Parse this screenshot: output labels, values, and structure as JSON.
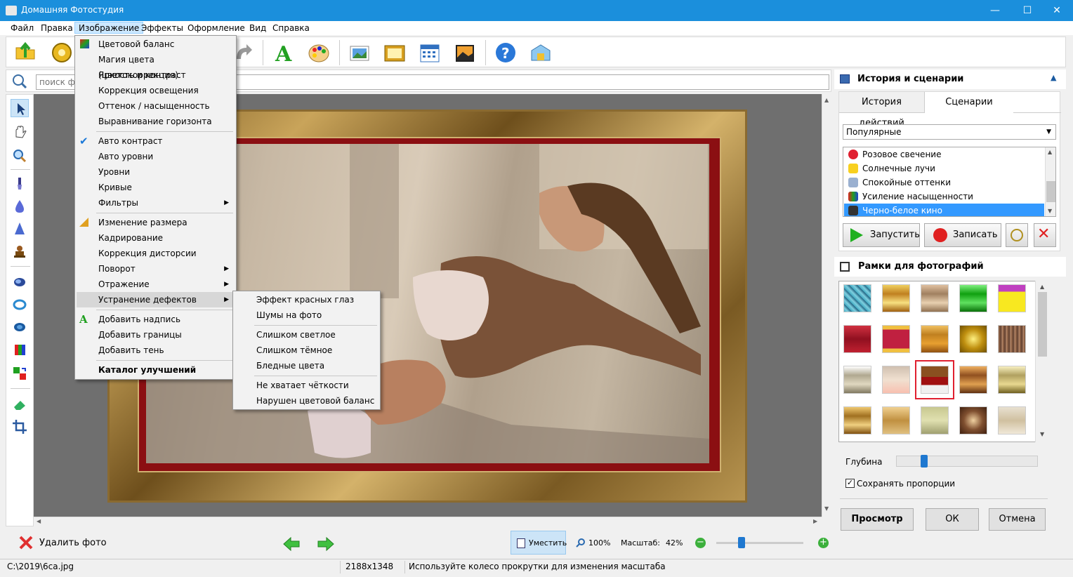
{
  "window": {
    "title": "Домашняя Фотостудия",
    "minimize": "—",
    "maximize": "☐",
    "close": "✕"
  },
  "menubar": [
    "Файл",
    "Правка",
    "Изображение",
    "Эффекты",
    "Оформление",
    "Вид",
    "Справка"
  ],
  "search": {
    "placeholder": "поиск функции"
  },
  "image_menu": {
    "items": [
      "Цветовой баланс",
      "Магия цвета (цветокоррекция)",
      "Яркость и контраст",
      "Коррекция освещения",
      "Оттенок / насыщенность",
      "Выравнивание горизонта",
      "Авто контраст",
      "Авто уровни",
      "Уровни",
      "Кривые",
      "Фильтры",
      "Изменение размера",
      "Кадрирование",
      "Коррекция дисторсии",
      "Поворот",
      "Отражение",
      "Устранение дефектов",
      "Добавить надпись",
      "Добавить границы",
      "Добавить тень",
      "Каталог улучшений"
    ]
  },
  "defects_submenu": {
    "items": [
      "Эффект красных глаз",
      "Шумы на фото",
      "Слишком светлое",
      "Слишком тёмное",
      "Бледные цвета",
      "Не хватает чёткости",
      "Нарушен цветовой баланс"
    ]
  },
  "history_panel": {
    "title": "История и сценарии",
    "tabs": [
      "История действий",
      "Сценарии"
    ],
    "category": "Популярные",
    "scenarios": [
      "Розовое свечение",
      "Солнечные лучи",
      "Спокойные оттенки",
      "Усиление насыщенности",
      "Черно-белое кино"
    ],
    "run_label": "Запустить",
    "record_label": "Записать"
  },
  "frames_panel": {
    "title": "Рамки для фотографий",
    "depth_label": "Глубина",
    "depth_value": 0.2,
    "keep_proportions_label": "Сохранять пропорции",
    "keep_proportions_checked": true,
    "preview_label": "Просмотр",
    "ok_label": "ОК",
    "cancel_label": "Отмена"
  },
  "bottom": {
    "delete_label": "Удалить фото",
    "fit_label": "Уместить",
    "zoom100_label": "100%",
    "scale_label": "Масштаб:",
    "scale_value": "42%"
  },
  "status": {
    "path": "C:\\2019\\6ca.jpg",
    "size": "2188x1348",
    "hint": "Используйте колесо прокрутки для изменения масштаба"
  }
}
